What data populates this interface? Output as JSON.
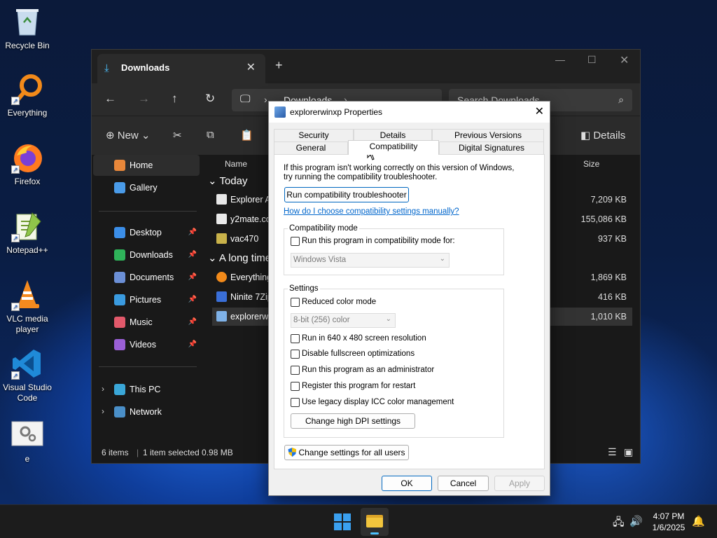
{
  "desktop": {
    "icons": [
      {
        "label": "Recycle Bin",
        "icon": "recycle-bin-icon"
      },
      {
        "label": "Everything",
        "icon": "everything-search-icon"
      },
      {
        "label": "Firefox",
        "icon": "firefox-icon"
      },
      {
        "label": "Notepad++",
        "icon": "notepad-plus-plus-icon"
      },
      {
        "label": "VLC media player",
        "icon": "vlc-icon"
      },
      {
        "label": "Visual Studio Code",
        "icon": "vscode-icon"
      },
      {
        "label": "e",
        "icon": "settings-app-icon"
      }
    ]
  },
  "explorer": {
    "tab_title": "Downloads",
    "address": "Downloads",
    "search_placeholder": "Search Downloads",
    "toolbar": {
      "new_label": "New",
      "details_label": "Details"
    },
    "sidebar": {
      "home": "Home",
      "gallery": "Gallery",
      "pinned": [
        {
          "label": "Desktop",
          "color": "#3b8ee8"
        },
        {
          "label": "Downloads",
          "color": "#2fb35a"
        },
        {
          "label": "Documents",
          "color": "#6b8fd6"
        },
        {
          "label": "Pictures",
          "color": "#3a9be0"
        },
        {
          "label": "Music",
          "color": "#e2596b"
        },
        {
          "label": "Videos",
          "color": "#9a5fd6"
        }
      ],
      "this_pc": "This PC",
      "network": "Network"
    },
    "columns": {
      "name": "Name",
      "size": "Size"
    },
    "groups": {
      "today": "Today",
      "long_ago": "A long time"
    },
    "files_today": [
      {
        "name": "Explorer A",
        "size": "7,209 KB"
      },
      {
        "name": "y2mate.co",
        "size": "155,086 KB"
      },
      {
        "name": "vac470",
        "size": "937 KB"
      }
    ],
    "files_old": [
      {
        "name": "Everything",
        "size": "1,869 KB"
      },
      {
        "name": "Ninite 7Zip",
        "size": "416 KB"
      },
      {
        "name": "explorerwi",
        "size": "1,010 KB"
      }
    ],
    "status": {
      "items": "6 items",
      "selected": "1 item selected  0.98 MB"
    }
  },
  "dialog": {
    "title": "explorerwinxp Properties",
    "tabs": {
      "row1": [
        "Security",
        "Details",
        "Previous Versions"
      ],
      "row2": [
        "General",
        "Compatibility",
        "Digital Signatures"
      ],
      "active": "Compatibility"
    },
    "intro_line1": "If this program isn't working correctly on this version of Windows,",
    "intro_line2": "try running the compatibility troubleshooter.",
    "troubleshooter_button": "Run compatibility troubleshooter",
    "help_link": "How do I choose compatibility settings manually?",
    "compat_mode": {
      "group_label": "Compatibility mode",
      "checkbox_label": "Run this program in compatibility mode for:",
      "selected_os": "Windows Vista"
    },
    "settings": {
      "group_label": "Settings",
      "reduced_color": "Reduced color mode",
      "color_value": "8-bit (256) color",
      "options": [
        "Run in 640 x 480 screen resolution",
        "Disable fullscreen optimizations",
        "Run this program as an administrator",
        "Register this program for restart",
        "Use legacy display ICC color management"
      ],
      "dpi_button": "Change high DPI settings"
    },
    "all_users_button": "Change settings for all users",
    "ok": "OK",
    "cancel": "Cancel",
    "apply": "Apply"
  },
  "taskbar": {
    "time": "4:07 PM",
    "date": "1/6/2025"
  }
}
